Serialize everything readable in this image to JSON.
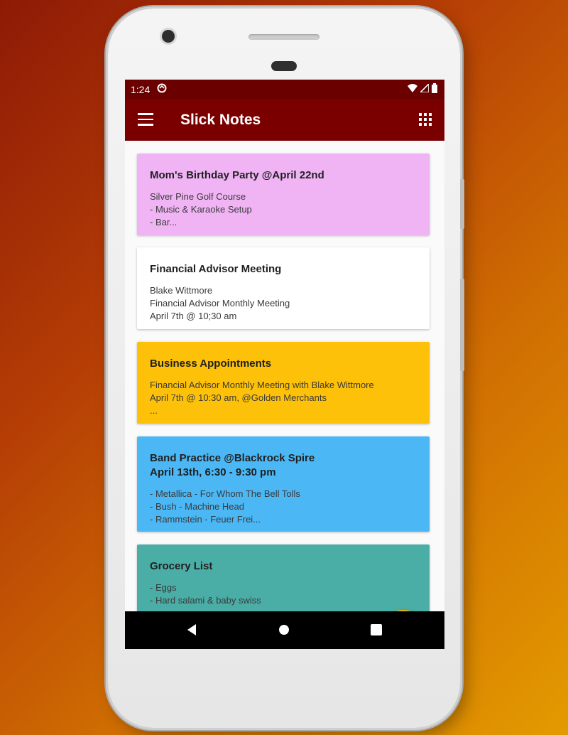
{
  "status_bar": {
    "time": "1:24",
    "sync_icon": "sync-icon",
    "wifi_icon": "wifi-icon",
    "signal_icon": "signal-icon",
    "battery_icon": "battery-icon"
  },
  "app_bar": {
    "title": "Slick Notes",
    "menu_icon": "hamburger-menu-icon",
    "layout_icon": "grid-view-icon"
  },
  "notes": [
    {
      "title": "Mom's Birthday Party @April 22nd",
      "subtitle": "",
      "body": "Silver Pine Golf Course\n- Music & Karaoke Setup\n- Bar...",
      "color": "#f0b4f5"
    },
    {
      "title": "Financial Advisor Meeting",
      "subtitle": "",
      "body": "Blake Wittmore\nFinancial Advisor Monthly Meeting\nApril 7th @ 10;30 am",
      "color": "#ffffff"
    },
    {
      "title": "Business Appointments",
      "subtitle": "",
      "body": "Financial Advisor Monthly Meeting with Blake Wittmore\nApril 7th @ 10:30 am, @Golden Merchants\n...",
      "color": "#fdc10a"
    },
    {
      "title": "Band Practice @Blackrock Spire",
      "subtitle": "April 13th, 6:30 - 9:30 pm",
      "body": "- Metallica - For Whom The Bell Tolls\n- Bush - Machine Head\n- Rammstein - Feuer Frei...",
      "color": "#4bb8f5"
    },
    {
      "title": "Grocery List",
      "subtitle": "",
      "body": "- Eggs\n- Hard salami & baby swiss",
      "color": "#4aaea6"
    }
  ],
  "fab": {
    "icon": "pencil-edit-icon",
    "color": "#f2b000"
  },
  "nav_bar": {
    "back_icon": "back-triangle-icon",
    "home_icon": "home-circle-icon",
    "recents_icon": "recents-square-icon"
  },
  "colors": {
    "status_bar": "#6b0000",
    "app_bar": "#7a0000"
  }
}
